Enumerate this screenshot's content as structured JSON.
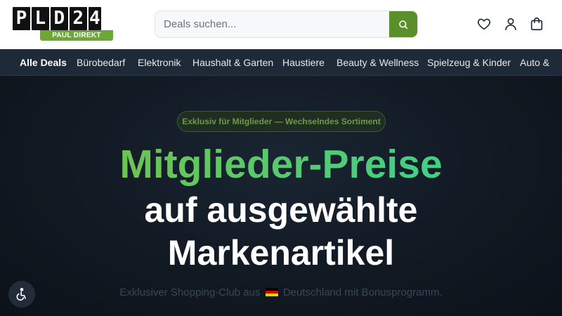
{
  "header": {
    "logo": {
      "letters": [
        "P",
        "L",
        "D",
        "2",
        "4"
      ],
      "subtitle": "PAUL DIREKT"
    },
    "search": {
      "placeholder": "Deals suchen...",
      "button_icon": "search-icon"
    },
    "icons": [
      "heart-icon",
      "user-icon",
      "shopping-bag-icon"
    ]
  },
  "nav": {
    "items": [
      {
        "label": "Alle Deals",
        "active": true
      },
      {
        "label": "Bürobedarf"
      },
      {
        "label": "Elektronik"
      },
      {
        "label": "Haushalt & Garten"
      },
      {
        "label": "Haustiere"
      },
      {
        "label": "Beauty & Wellness"
      },
      {
        "label": "Spielzeug & Kinder"
      },
      {
        "label": "Auto &"
      }
    ]
  },
  "hero": {
    "badge": "Exklusiv für Mitglieder — Wechselndes Sortiment",
    "headline_1": "Mitglieder-Preise",
    "headline_2": "auf ausgewählte",
    "headline_3": "Markenartikel",
    "subtitle_before": "Exklusiver Shopping-Club aus",
    "subtitle_after": "Deutschland mit Bonusprogramm."
  },
  "colors": {
    "brand_green": "#5b8f2a",
    "nav_bg": "#1e2a38",
    "hero_bg": "#111922"
  }
}
